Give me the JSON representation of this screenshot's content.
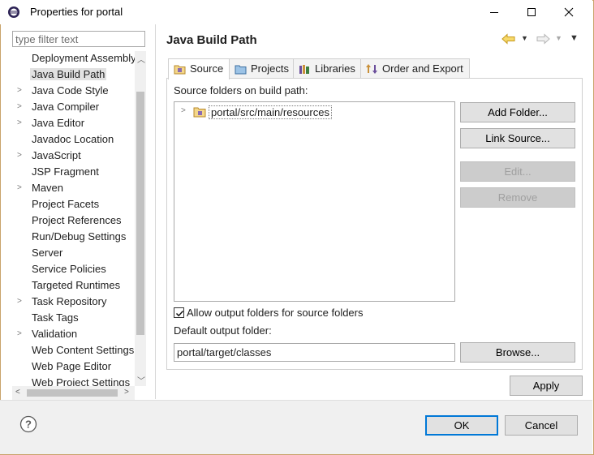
{
  "window": {
    "title": "Properties for portal",
    "controls": {
      "minimize": "minimize",
      "maximize": "maximize",
      "close": "close"
    }
  },
  "filter": {
    "placeholder": "type filter text",
    "value": ""
  },
  "tree": {
    "items": [
      {
        "label": "Deployment Assembly",
        "expandable": false,
        "selected": false
      },
      {
        "label": "Java Build Path",
        "expandable": false,
        "selected": true
      },
      {
        "label": "Java Code Style",
        "expandable": true,
        "selected": false
      },
      {
        "label": "Java Compiler",
        "expandable": true,
        "selected": false
      },
      {
        "label": "Java Editor",
        "expandable": true,
        "selected": false
      },
      {
        "label": "Javadoc Location",
        "expandable": false,
        "selected": false
      },
      {
        "label": "JavaScript",
        "expandable": true,
        "selected": false
      },
      {
        "label": "JSP Fragment",
        "expandable": false,
        "selected": false
      },
      {
        "label": "Maven",
        "expandable": true,
        "selected": false
      },
      {
        "label": "Project Facets",
        "expandable": false,
        "selected": false
      },
      {
        "label": "Project References",
        "expandable": false,
        "selected": false
      },
      {
        "label": "Run/Debug Settings",
        "expandable": false,
        "selected": false
      },
      {
        "label": "Server",
        "expandable": false,
        "selected": false
      },
      {
        "label": "Service Policies",
        "expandable": false,
        "selected": false
      },
      {
        "label": "Targeted Runtimes",
        "expandable": false,
        "selected": false
      },
      {
        "label": "Task Repository",
        "expandable": true,
        "selected": false
      },
      {
        "label": "Task Tags",
        "expandable": false,
        "selected": false
      },
      {
        "label": "Validation",
        "expandable": true,
        "selected": false
      },
      {
        "label": "Web Content Settings",
        "expandable": false,
        "selected": false
      },
      {
        "label": "Web Page Editor",
        "expandable": false,
        "selected": false
      },
      {
        "label": "Web Project Settings",
        "expandable": false,
        "selected": false
      }
    ]
  },
  "section": {
    "title": "Java Build Path"
  },
  "tabs": [
    {
      "label": "Source",
      "icon": "source-folder-icon",
      "active": true
    },
    {
      "label": "Projects",
      "icon": "projects-folder-icon",
      "active": false
    },
    {
      "label": "Libraries",
      "icon": "libraries-icon",
      "active": false
    },
    {
      "label": "Order and Export",
      "icon": "order-export-icon",
      "active": false
    }
  ],
  "source_tab": {
    "list_label": "Source folders on build path:",
    "folders": [
      {
        "label": "portal/src/main/resources"
      }
    ],
    "buttons": {
      "add_folder": "Add Folder...",
      "link_source": "Link Source...",
      "edit": "Edit...",
      "remove": "Remove"
    },
    "allow_output_label": "Allow output folders for source folders",
    "allow_output_checked": true,
    "output_folder_label": "Default output folder:",
    "output_folder_value": "portal/target/classes",
    "browse": "Browse..."
  },
  "apply": "Apply",
  "footer": {
    "ok": "OK",
    "cancel": "Cancel",
    "help_icon": "help-icon"
  },
  "colors": {
    "accent": "#0078d7",
    "selection": "#e1e1e1",
    "frame": "#c9a36b"
  }
}
